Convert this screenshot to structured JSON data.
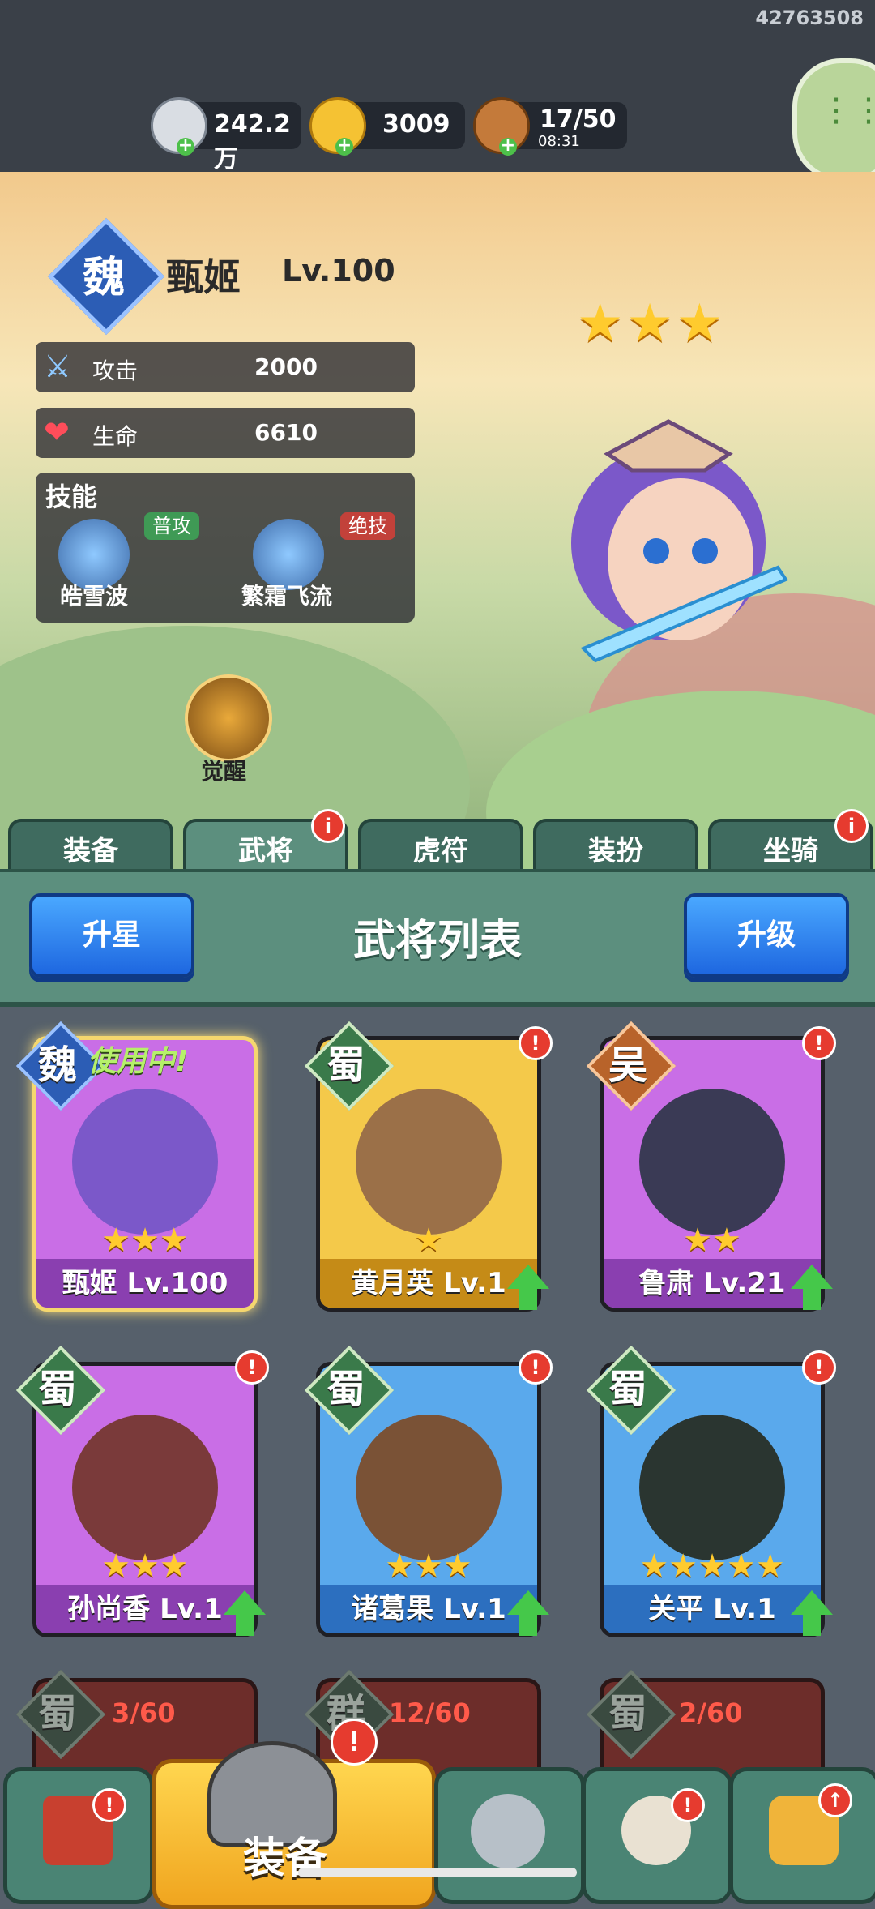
{
  "uid": "42763508",
  "resources": {
    "silver": "242.2万",
    "gold": "3009",
    "stamina": "17/50",
    "stamina_timer": "08:31"
  },
  "hero": {
    "faction": "魏",
    "name": "甄姬",
    "level": "Lv.100",
    "stars": "★★★",
    "attack_label": "攻击",
    "attack_value": "2000",
    "hp_label": "生命",
    "hp_value": "6610",
    "skills_title": "技能",
    "skill1_tag": "普攻",
    "skill1_name": "皓雪波",
    "skill2_tag": "绝技",
    "skill2_name": "繁霜飞流",
    "awaken_label": "觉醒"
  },
  "tabs": [
    "装备",
    "武将",
    "虎符",
    "装扮",
    "坐骑"
  ],
  "list_header": {
    "left_button": "升星",
    "title": "武将列表",
    "right_button": "升级"
  },
  "cards": [
    {
      "faction": "魏",
      "label": "甄姬 Lv.100",
      "stars": "★★★",
      "in_use": "使用中!"
    },
    {
      "faction": "蜀",
      "label": "黄月英 Lv.1",
      "stars": "★"
    },
    {
      "faction": "吴",
      "label": "鲁肃 Lv.21",
      "stars": "★★"
    },
    {
      "faction": "蜀",
      "label": "孙尚香 Lv.1",
      "stars": "★★★"
    },
    {
      "faction": "蜀",
      "label": "诸葛果 Lv.1",
      "stars": "★★★"
    },
    {
      "faction": "蜀",
      "label": "关平 Lv.1",
      "stars": "★★★★★"
    }
  ],
  "locked_cards": [
    {
      "faction": "蜀",
      "progress": "3/60"
    },
    {
      "faction": "群",
      "progress": "12/60"
    },
    {
      "faction": "蜀",
      "progress": "2/60"
    }
  ],
  "bottom_nav": {
    "active_label": "装备"
  },
  "colors": {
    "purple_card": "#c96ee6",
    "gold_card": "#f4c94a",
    "blue_card": "#5aa9ec",
    "accent_green": "#5c8f7e",
    "badge_red": "#e63b2f"
  }
}
